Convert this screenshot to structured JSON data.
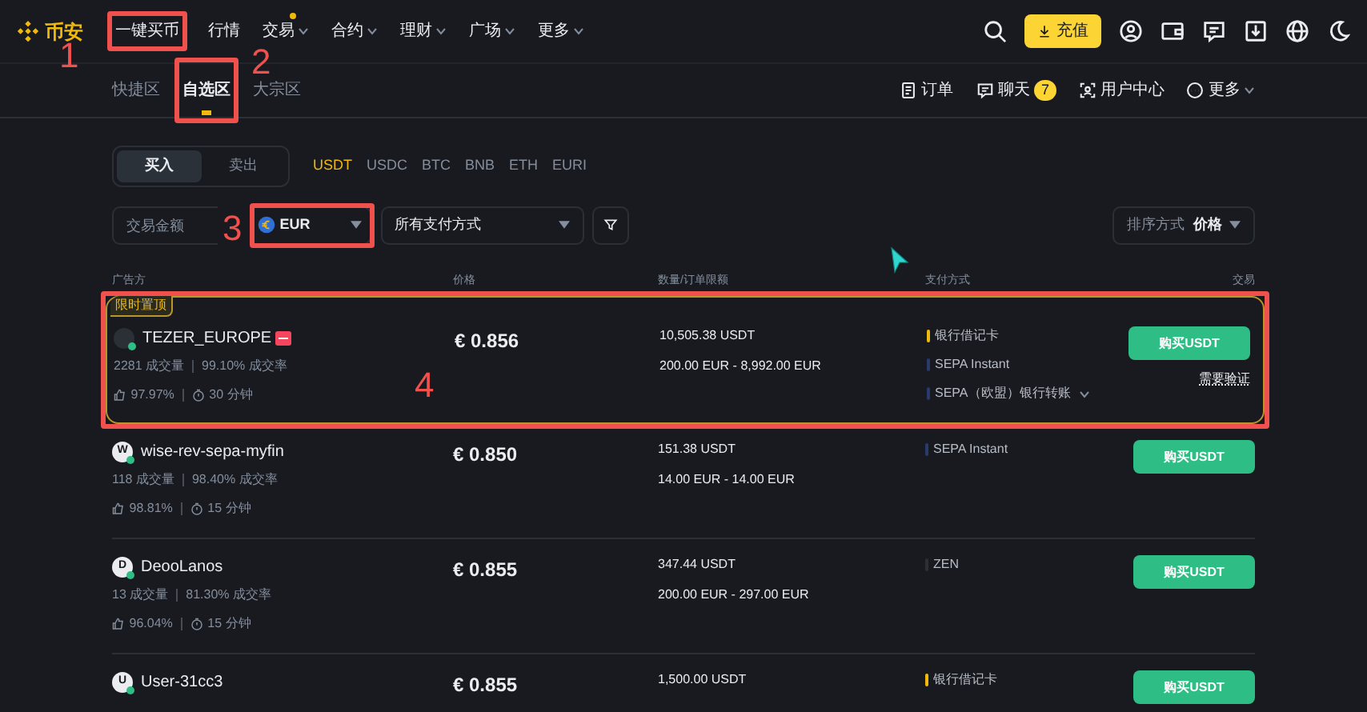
{
  "nav": {
    "logo": "币安",
    "items": [
      {
        "label": "一键买币",
        "dropdown": false,
        "dot": false
      },
      {
        "label": "行情",
        "dropdown": false,
        "dot": false
      },
      {
        "label": "交易",
        "dropdown": true,
        "dot": true
      },
      {
        "label": "合约",
        "dropdown": true,
        "dot": false
      },
      {
        "label": "理财",
        "dropdown": true,
        "dot": false
      },
      {
        "label": "广场",
        "dropdown": true,
        "dot": false
      },
      {
        "label": "更多",
        "dropdown": true,
        "dot": false
      }
    ],
    "deposit": "充值"
  },
  "zones": [
    {
      "label": "快捷区",
      "selected": false
    },
    {
      "label": "自选区",
      "selected": true
    },
    {
      "label": "大宗区",
      "selected": false
    }
  ],
  "sublinks": [
    {
      "kind": "orders",
      "label": "订单"
    },
    {
      "kind": "chat",
      "label": "聊天",
      "badge": "7"
    },
    {
      "kind": "user",
      "label": "用户中心"
    },
    {
      "kind": "more",
      "label": "更多"
    }
  ],
  "sides": [
    {
      "label": "买入",
      "selected": true
    },
    {
      "label": "卖出",
      "selected": false
    }
  ],
  "assets": [
    {
      "label": "USDT",
      "selected": true
    },
    {
      "label": "USDC",
      "selected": false
    },
    {
      "label": "BTC",
      "selected": false
    },
    {
      "label": "BNB",
      "selected": false
    },
    {
      "label": "ETH",
      "selected": false
    },
    {
      "label": "EURI",
      "selected": false
    }
  ],
  "filters": {
    "amount_placeholder": "交易金额",
    "currency": "EUR",
    "payment": "所有支付方式",
    "sort_label": "排序方式",
    "sort_value": "价格"
  },
  "columns": [
    "广告方",
    "价格",
    "数量/订单限额",
    "支付方式",
    "交易"
  ],
  "rows": [
    {
      "promoted": true,
      "tag": "限时置顶",
      "name": "TEZER_EUROPE",
      "verified_badge": true,
      "stats": [
        "2281 成交量",
        "99.10% 成交率"
      ],
      "rating": [
        "97.97%",
        "30 分钟"
      ],
      "price": "€ 0.856",
      "amount": "10,505.38 USDT",
      "limit": "200.00 EUR - 8,992.00 EUR",
      "payments": [
        {
          "label": "银行借记卡",
          "color": "#f0b90b",
          "expand": false
        },
        {
          "label": "SEPA Instant",
          "color": "#2a3a6a",
          "expand": false
        },
        {
          "label": "SEPA（欧盟）银行转账",
          "color": "#2a3a6a",
          "expand": true
        }
      ],
      "button": "购买USDT",
      "note": "需要验证"
    },
    {
      "promoted": false,
      "name": "wise-rev-sepa-myfin",
      "avatar": "W",
      "verified_badge": false,
      "stats": [
        "118 成交量",
        "98.40% 成交率"
      ],
      "rating": [
        "98.81%",
        "15 分钟"
      ],
      "price": "€ 0.850",
      "amount": "151.38 USDT",
      "limit": "14.00 EUR - 14.00 EUR",
      "payments": [
        {
          "label": "SEPA Instant",
          "color": "#2a3a6a",
          "expand": false
        }
      ],
      "button": "购买USDT"
    },
    {
      "promoted": false,
      "name": "DeooLanos",
      "avatar": "D",
      "verified_badge": false,
      "stats": [
        "13 成交量",
        "81.30% 成交率"
      ],
      "rating": [
        "96.04%",
        "15 分钟"
      ],
      "price": "€ 0.855",
      "amount": "347.44 USDT",
      "limit": "200.00 EUR - 297.00 EUR",
      "payments": [
        {
          "label": "ZEN",
          "color": "#2b2f36",
          "expand": false
        }
      ],
      "button": "购买USDT"
    },
    {
      "promoted": false,
      "name": "User-31cc3",
      "avatar": "U",
      "verified_badge": false,
      "price": "€ 0.855",
      "amount": "1,500.00 USDT",
      "payments": [
        {
          "label": "银行借记卡",
          "color": "#f0b90b",
          "expand": false
        }
      ],
      "button": "购买USDT"
    }
  ],
  "annotations": [
    {
      "label": "1"
    },
    {
      "label": "2"
    },
    {
      "label": "3"
    },
    {
      "label": "4"
    }
  ]
}
